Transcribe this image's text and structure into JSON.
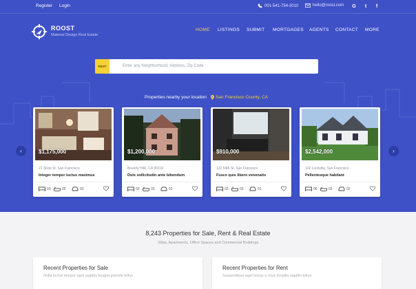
{
  "topbar": {
    "register": "Register",
    "login": "Login",
    "phone": "001-541-754-3010",
    "email": "hello@roost.com",
    "social": [
      "google-icon",
      "twitter-icon",
      "facebook-icon"
    ]
  },
  "brand": {
    "name": "ROOST",
    "tagline": "Material Design Real Estate"
  },
  "nav": [
    "HOME",
    "LISTINGS",
    "SUBMIT",
    "MORTGAGES",
    "AGENTS",
    "CONTACT",
    "MORE"
  ],
  "search": {
    "tag": "RENT",
    "placeholder": "Enter any Neighborhood, Address, Zip Code"
  },
  "nearby": {
    "label": "Properties nearby your location",
    "location": "San Francisco County, CA"
  },
  "listings": [
    {
      "price": "$1,175,000",
      "address": "21 Shop St, San Francisco",
      "title": "Integer tempor luctus maximus",
      "beds": "03",
      "baths": "02",
      "garage": "02"
    },
    {
      "price": "$1,200,000",
      "address": "Beverly Hills, CA 90210",
      "title": "Duis sollicitudin ante bibendum",
      "beds": "03",
      "baths": "03",
      "garage": "01"
    },
    {
      "price": "$910,000",
      "address": "132 54th St, San Francisco",
      "title": "Fusce quis libero venenatis",
      "beds": "03",
      "baths": "03",
      "garage": "01"
    },
    {
      "price": "$2,542,000",
      "address": "132 Lockslby, San Francisco",
      "title": "Pellentesque habitant",
      "beds": "06",
      "baths": "03",
      "garage": "02"
    }
  ],
  "section": {
    "title": "8,243 Properties for Sale, Rent & Real Estate",
    "subtitle": "Villas, Apartments, Office Spaces and Commercial Buildings"
  },
  "panels": [
    {
      "title": "Recent Properties for Sale",
      "sub": "Nulla luctus tempor eget sagittis feugiat gravida tellus"
    },
    {
      "title": "Recent Properties for Rent",
      "sub": "Suspendisse eget lectus a risus fringilla sagittis tellus"
    }
  ],
  "colors": {
    "primary": "#3f51c7",
    "accent": "#f5d136"
  }
}
